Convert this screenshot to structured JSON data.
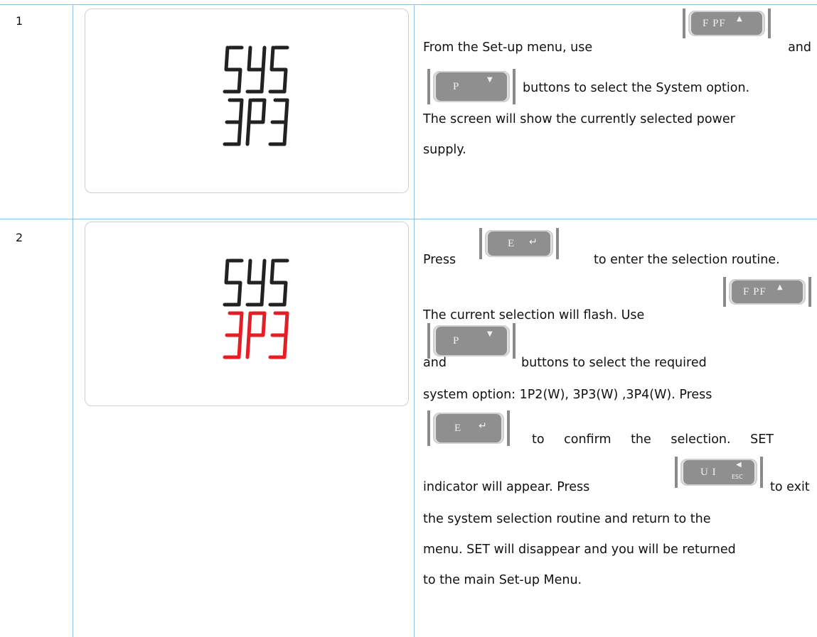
{
  "rows": [
    {
      "number": "1",
      "display": {
        "line1": "SYS",
        "line2": "3P3",
        "line2_color": "#222222"
      },
      "lines": [
        "From the Set-up menu, use",
        "and",
        "buttons to select the System option.",
        "The screen will show the currently selected power",
        "supply."
      ]
    },
    {
      "number": "2",
      "display": {
        "line1": "SYS",
        "line2": "3P3",
        "line2_color": "#e31e24"
      },
      "lines": [
        "Press",
        "to enter the selection routine.",
        "The current selection will flash. Use",
        "and",
        "buttons to select the required",
        "system option: 1P2(W), 3P3(W) ,3P4(W). Press",
        "to confirm the selection. SET",
        "indicator will appear. Press",
        "to exit",
        "the system selection routine and return to the",
        "menu. SET will disappear and you will be returned",
        "to the main Set-up Menu."
      ]
    }
  ],
  "buttons": {
    "fpf": {
      "label": "F PF",
      "icon": "up-arrow-icon"
    },
    "p": {
      "label": "P",
      "icon": "down-arrow-icon"
    },
    "e": {
      "label": "E",
      "icon": "enter-arrow-icon"
    },
    "ui": {
      "label": "U I",
      "sub": "ESC",
      "icon": "left-arrow-icon"
    }
  },
  "colors": {
    "grid_line": "#8fc0e6",
    "segment_dark": "#222222",
    "segment_red": "#e31e24",
    "button_face": "#8f8f8f"
  }
}
